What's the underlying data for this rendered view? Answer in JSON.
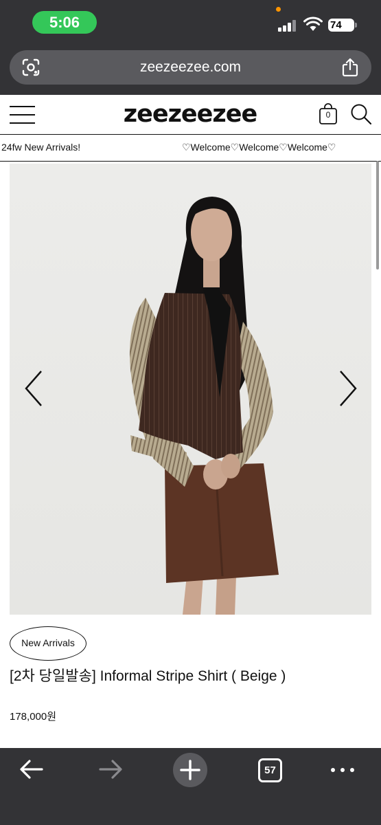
{
  "status_bar": {
    "time": "5:06",
    "battery": "74",
    "colors": {
      "time_pill": "#34c759",
      "recording_dot": "#ff9500"
    }
  },
  "browser": {
    "url": "zeezeezee.com",
    "open_tabs": "57",
    "icons": [
      "lens-icon",
      "share-icon",
      "back-arrow-icon",
      "forward-arrow-icon",
      "plus-icon",
      "tabs-icon",
      "more-icon"
    ]
  },
  "site": {
    "logo": "zeezeezee",
    "cart_count": "0",
    "marquee_left": "24fw New Arrivals!",
    "marquee_right": "♡Welcome♡Welcome♡Welcome♡"
  },
  "product": {
    "badge": "New Arrivals",
    "name": "[2차 당일발송] Informal Stripe Shirt ( Beige )",
    "price": "178,000원",
    "image_alt": "Model wearing striped shirt, brown vest and brown skirt",
    "colors": {
      "shirt": "#b3a488",
      "vest": "#3e2820",
      "skirt": "#5c3424",
      "background": "#e9e9e7"
    }
  }
}
